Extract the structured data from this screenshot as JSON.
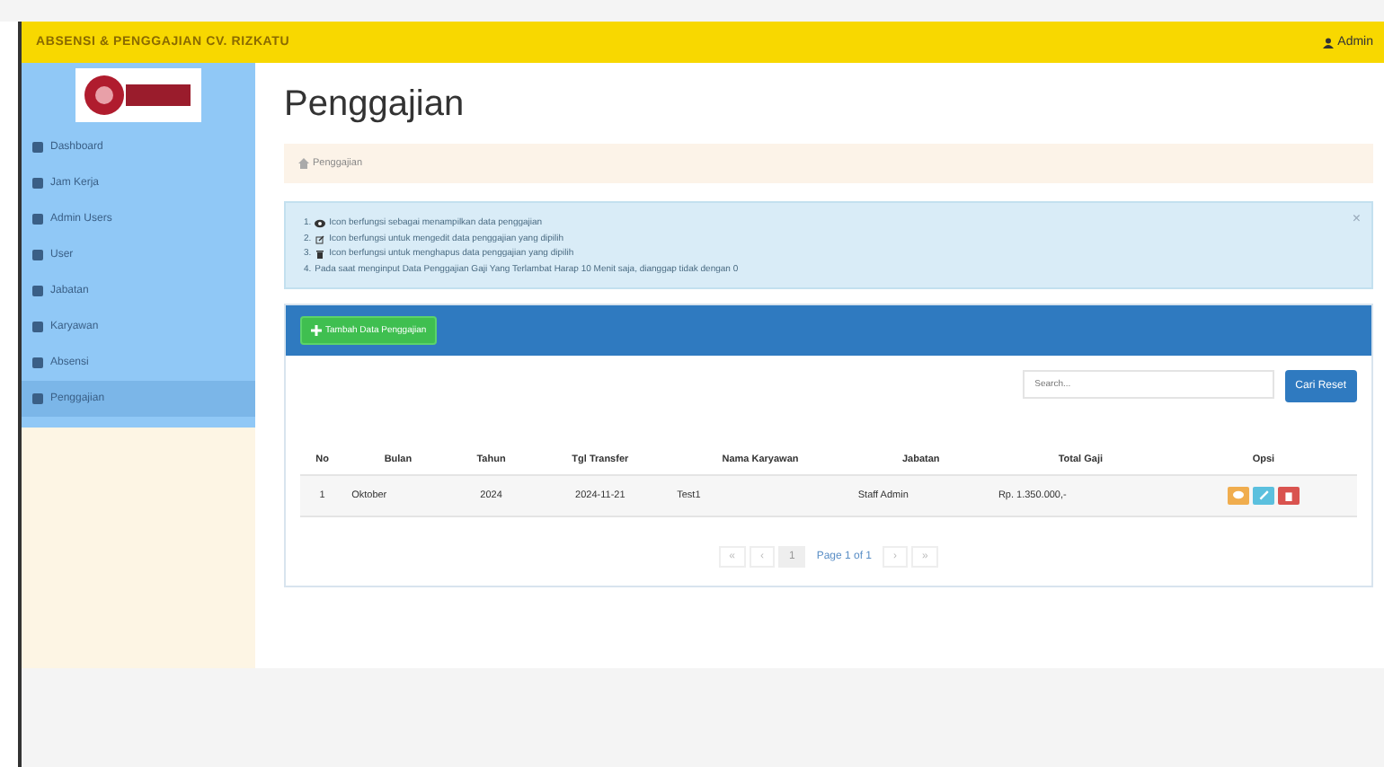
{
  "topbar": {
    "title": "ABSENSI & PENGGAJIAN CV. RIZKATU",
    "user": "Admin"
  },
  "sidebar": {
    "items": [
      {
        "label": "Dashboard",
        "selected": false
      },
      {
        "label": "Jam Kerja",
        "selected": false
      },
      {
        "label": "Admin Users",
        "selected": false
      },
      {
        "label": "User",
        "selected": false
      },
      {
        "label": "Jabatan",
        "selected": false
      },
      {
        "label": "Karyawan",
        "selected": false
      },
      {
        "label": "Absensi",
        "selected": false
      },
      {
        "label": "Penggajian",
        "selected": true
      }
    ]
  },
  "page": {
    "title": "Penggajian",
    "breadcrumb": "Penggajian"
  },
  "info": {
    "items": [
      {
        "number": "1.",
        "text": "Icon berfungsi sebagai menampilkan data penggajian"
      },
      {
        "number": "2.",
        "text": "Icon berfungsi untuk mengedit data penggajian yang dipilih"
      },
      {
        "number": "3.",
        "text": "Icon berfungsi untuk menghapus data penggajian yang dipilih"
      },
      {
        "number": "4.",
        "text": "Pada saat menginput Data Penggajian Gaji Yang Terlambat Harap 10 Menit saja, dianggap tidak dengan 0"
      }
    ],
    "close": "×"
  },
  "panel": {
    "add_button": "Tambah Data Penggajian",
    "search": {
      "placeholder": "Search..."
    },
    "reset_button": "Cari Reset"
  },
  "table": {
    "columns": [
      "No",
      "Bulan",
      "Tahun",
      "Tgl Transfer",
      "Nama Karyawan",
      "Jabatan",
      "Total Gaji",
      "Opsi"
    ],
    "rows": [
      {
        "cells": [
          "1",
          "Oktober",
          "2024",
          "2024-11-21",
          "Test1",
          "Staff Admin",
          "Rp. 1.350.000,-"
        ]
      }
    ]
  },
  "pagination": {
    "prev": [
      "«",
      "‹"
    ],
    "current": "1",
    "label": "Page 1 of 1",
    "next": [
      "›",
      "»"
    ]
  }
}
